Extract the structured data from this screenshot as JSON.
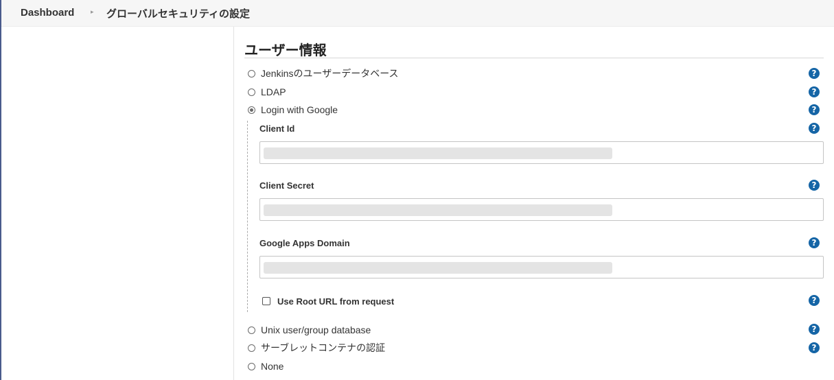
{
  "breadcrumb": {
    "home": "Dashboard",
    "separator": "▸",
    "current": "グローバルセキュリティの設定"
  },
  "section": {
    "title": "ユーザー情報"
  },
  "security_realm": {
    "options": [
      {
        "label": "Jenkinsのユーザーデータベース",
        "checked": false
      },
      {
        "label": "LDAP",
        "checked": false
      },
      {
        "label": "Login with Google",
        "checked": true
      },
      {
        "label": "Unix user/group database",
        "checked": false
      },
      {
        "label": "サーブレットコンテナの認証",
        "checked": false
      },
      {
        "label": "None",
        "checked": false
      }
    ]
  },
  "google_login": {
    "client_id_label": "Client Id",
    "client_secret_label": "Client Secret",
    "apps_domain_label": "Google Apps Domain",
    "use_root_url_label": "Use Root URL from request",
    "use_root_url_checked": false
  },
  "help_icon": "?",
  "colors": {
    "help_icon_bg": "#1565a6",
    "sidebar_border": "#4a5b8c"
  }
}
